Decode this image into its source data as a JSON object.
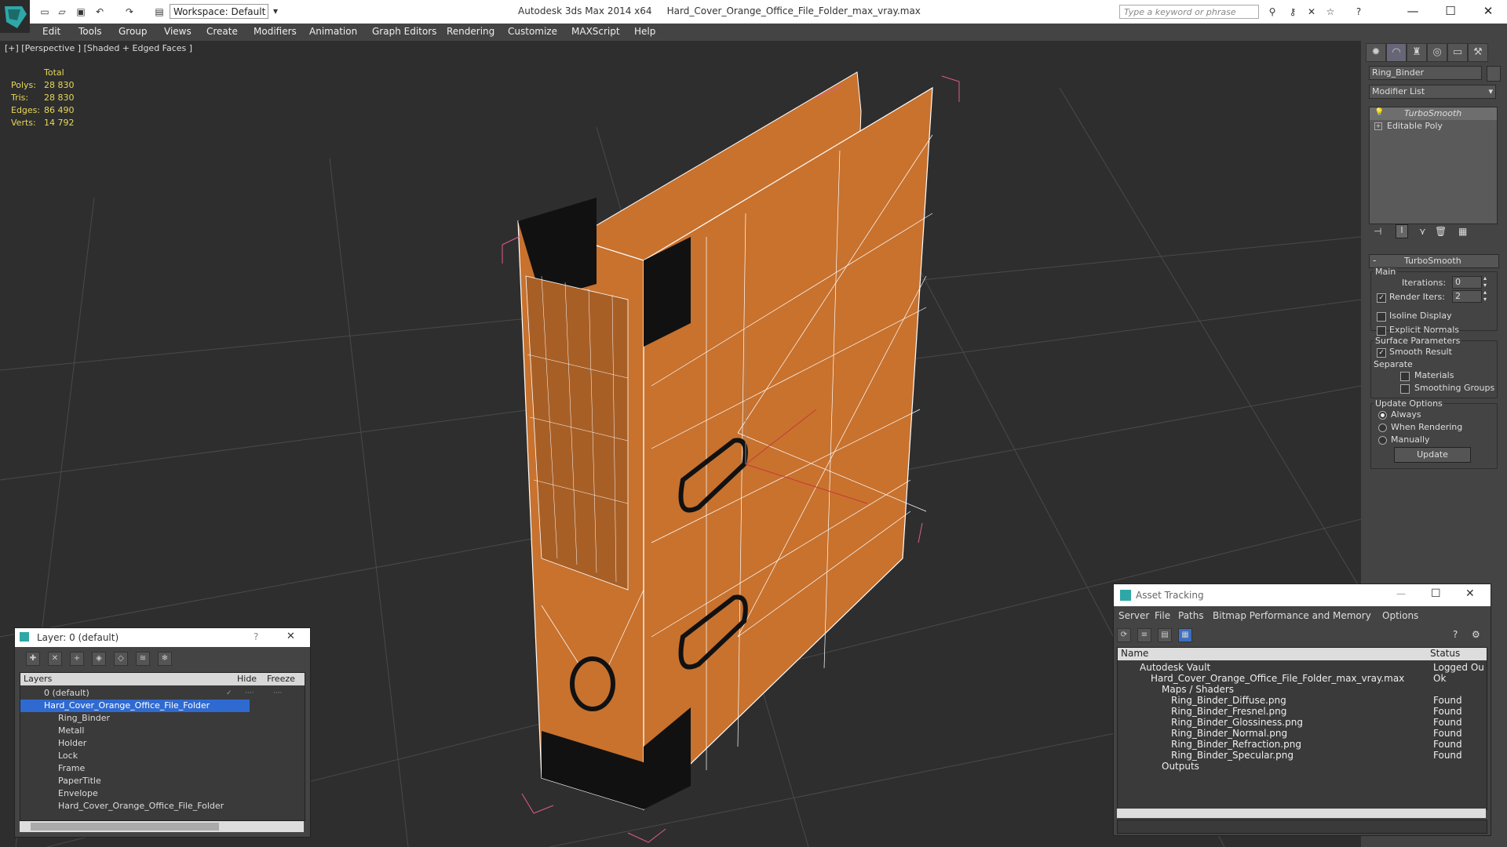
{
  "titlebar": {
    "app": "Autodesk 3ds Max  2014 x64",
    "file": "Hard_Cover_Orange_Office_File_Folder_max_vray.max",
    "workspace": "Workspace: Default",
    "search_placeholder": "Type a keyword or phrase"
  },
  "menu": [
    "Edit",
    "Tools",
    "Group",
    "Views",
    "Create",
    "Modifiers",
    "Animation",
    "Graph Editors",
    "Rendering",
    "Customize",
    "MAXScript",
    "Help"
  ],
  "viewport": {
    "label": "[+] [Perspective ] [Shaded + Edged Faces ]",
    "stats": {
      "header": "Total",
      "polys_label": "Polys:",
      "polys": "28 830",
      "tris_label": "Tris:",
      "tris": "28 830",
      "edges_label": "Edges:",
      "edges": "86 490",
      "verts_label": "Verts:",
      "verts": "14 792"
    },
    "model_color": "#c8722e",
    "wire_color": "#ffffff",
    "bbox_color": "#e05a8c"
  },
  "command_panel": {
    "object_name": "Ring_Binder",
    "modifier_list": "Modifier List",
    "stack": [
      "TurboSmooth",
      "Editable Poly"
    ],
    "rollout_title": "TurboSmooth",
    "main_label": "Main",
    "iterations_label": "Iterations:",
    "iterations": "0",
    "render_iters_label": "Render Iters:",
    "render_iters": "2",
    "render_iters_checked": true,
    "isoline": "Isoline Display",
    "explicit": "Explicit Normals",
    "surface_params": "Surface Parameters",
    "smooth_result": "Smooth Result",
    "separate": "Separate",
    "materials": "Materials",
    "smoothing_groups": "Smoothing Groups",
    "update_options": "Update Options",
    "always": "Always",
    "when_rendering": "When Rendering",
    "manually": "Manually",
    "update_btn": "Update"
  },
  "layer_window": {
    "title": "Layer: 0 (default)",
    "col_layers": "Layers",
    "col_hide": "Hide",
    "col_freeze": "Freeze",
    "rows": [
      "0 (default)",
      "Hard_Cover_Orange_Office_File_Folder",
      "Ring_Binder",
      "Metall",
      "Holder",
      "Lock",
      "Frame",
      "PaperTitle",
      "Envelope",
      "Hard_Cover_Orange_Office_File_Folder"
    ]
  },
  "asset_window": {
    "title": "Asset Tracking",
    "menus": [
      "Server",
      "File",
      "Paths",
      "Bitmap Performance and Memory",
      "Options"
    ],
    "col_name": "Name",
    "col_status": "Status",
    "rows": [
      {
        "name": "Autodesk Vault",
        "status": "Logged Ou"
      },
      {
        "name": "Hard_Cover_Orange_Office_File_Folder_max_vray.max",
        "status": "Ok"
      },
      {
        "name": "Maps / Shaders",
        "status": ""
      },
      {
        "name": "Ring_Binder_Diffuse.png",
        "status": "Found"
      },
      {
        "name": "Ring_Binder_Fresnel.png",
        "status": "Found"
      },
      {
        "name": "Ring_Binder_Glossiness.png",
        "status": "Found"
      },
      {
        "name": "Ring_Binder_Normal.png",
        "status": "Found"
      },
      {
        "name": "Ring_Binder_Refraction.png",
        "status": "Found"
      },
      {
        "name": "Ring_Binder_Specular.png",
        "status": "Found"
      },
      {
        "name": "Outputs",
        "status": ""
      }
    ]
  }
}
